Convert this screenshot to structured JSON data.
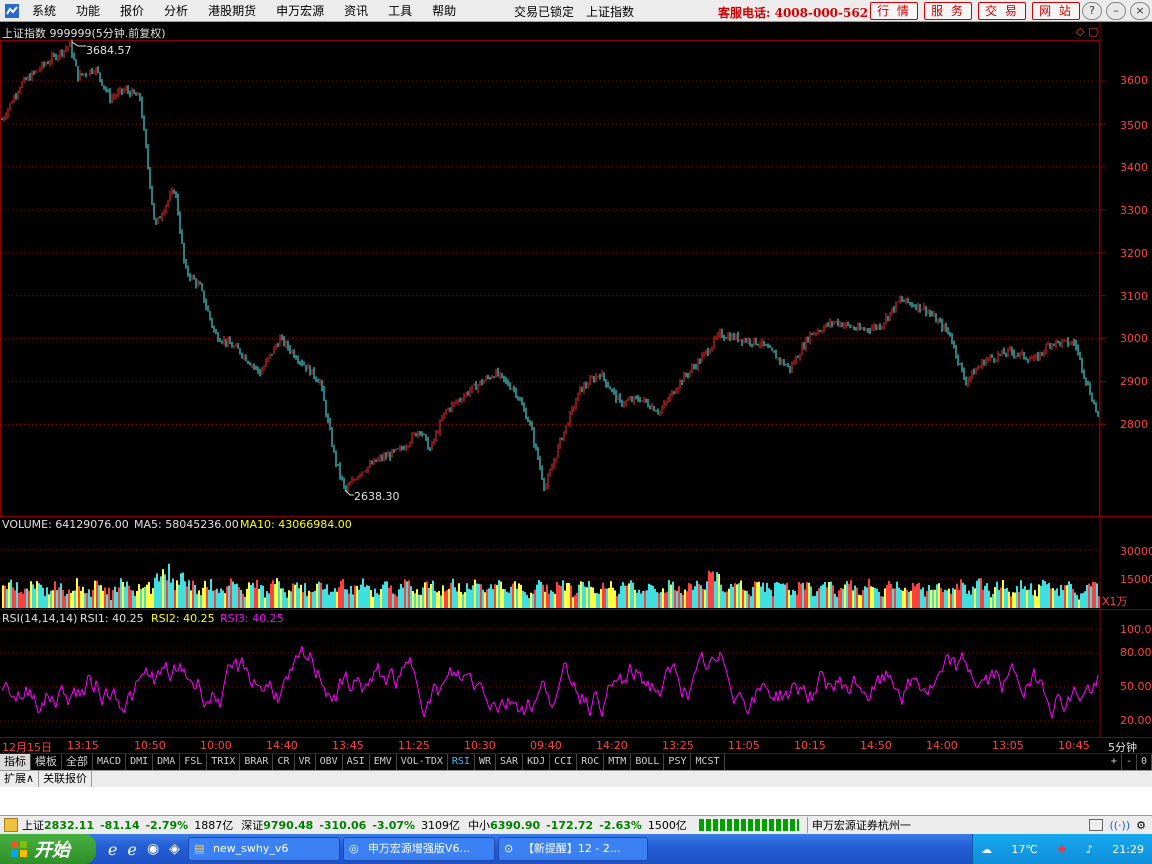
{
  "menubar": {
    "items": [
      "系统",
      "功能",
      "报价",
      "分析",
      "港股期货",
      "申万宏源",
      "资讯",
      "工具",
      "帮助"
    ],
    "lock_status": "交易已锁定",
    "current_index": "上证指数",
    "hotline": "客服电话: 4008-000-562",
    "top_buttons": [
      "行 情",
      "服 务",
      "交 易",
      "网 站"
    ]
  },
  "main_chart": {
    "title": "上证指数 999999(5分钟.前复权)",
    "high_label": "3684.57",
    "low_label": "2638.30",
    "y_ticks": [
      "3600",
      "3500",
      "3400",
      "3300",
      "3200",
      "3100",
      "3000",
      "2900",
      "2800"
    ]
  },
  "volume_panel": {
    "label": "VOLUME: 64129076.00",
    "ma5": "MA5: 58045236.00",
    "ma10": "MA10: 43066984.00",
    "y_ticks": [
      "30000",
      "15000"
    ],
    "unit": "X1万"
  },
  "rsi_panel": {
    "label": "RSI(14,14,14)",
    "rsi1": "RSI1: 40.25",
    "rsi2": "RSI2: 40.25",
    "rsi3": "RSI3: 40.25",
    "y_ticks": [
      "100.00",
      "80.00",
      "50.00",
      "20.00"
    ]
  },
  "x_axis": {
    "ticks": [
      "12月15日",
      "13:15",
      "10:50",
      "10:00",
      "14:40",
      "13:45",
      "11:25",
      "10:30",
      "09:40",
      "14:20",
      "13:25",
      "11:05",
      "10:15",
      "14:50",
      "14:00",
      "13:05",
      "10:45"
    ],
    "period": "5分钟"
  },
  "tabs": [
    "指标",
    "模板",
    "全部",
    "MACD",
    "DMI",
    "DMA",
    "FSL",
    "TRIX",
    "BRAR",
    "CR",
    "VR",
    "OBV",
    "ASI",
    "EMV",
    "VOL-TDX",
    "RSI",
    "WR",
    "SAR",
    "KDJ",
    "CCI",
    "ROC",
    "MTM",
    "BOLL",
    "PSY",
    "MCST"
  ],
  "tab_controls": [
    "+",
    "-",
    "0"
  ],
  "row2": [
    "扩展∧",
    "关联报价"
  ],
  "status": {
    "sh_name": "上证",
    "sh_price": "2832.11",
    "sh_chg": "-81.14",
    "sh_pct": "-2.79%",
    "sh_amt": "1887亿",
    "sz_name": "深证",
    "sz_price": "9790.48",
    "sz_chg": "-310.06",
    "sz_pct": "-3.07%",
    "sz_amt": "3109亿",
    "zx_name": "中小",
    "zx_price": "6390.90",
    "zx_chg": "-172.72",
    "zx_pct": "-2.63%",
    "zx_amt": "1500亿",
    "broker": "申万宏源证券杭州一"
  },
  "taskbar": {
    "start": "开始",
    "tasks": [
      "new_swhy_v6",
      "申万宏源增强版V6...",
      "【新提醒】12 - 2..."
    ],
    "weather": "17℃",
    "time": "21:29"
  },
  "colors": {
    "up": "#ff3030",
    "down": "#50ffff",
    "rsi": "#ff00ff",
    "grid": "#8a0000",
    "ma10": "#ffff00"
  }
}
